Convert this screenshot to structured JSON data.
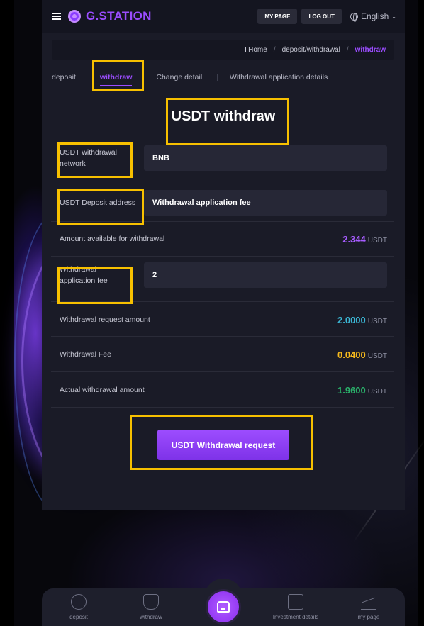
{
  "header": {
    "logo_text": "G.STATION",
    "my_page_label": "MY PAGE",
    "logout_label": "LOG OUT",
    "language": "English"
  },
  "breadcrumb": {
    "home": "Home",
    "section": "deposit/withdrawal",
    "current": "withdraw"
  },
  "tabs": [
    {
      "label": "deposit"
    },
    {
      "label": "withdraw",
      "active": true
    },
    {
      "label": "Change detail"
    },
    {
      "label": "Withdrawal application details"
    }
  ],
  "page_title": "USDT withdraw",
  "form": {
    "network": {
      "label": "USDT withdrawal network",
      "value": "BNB"
    },
    "deposit_address": {
      "label": "USDT Deposit address",
      "value": "Withdrawal application fee"
    },
    "available": {
      "label": "Amount available for withdrawal",
      "amount": "2.344",
      "unit": "USDT"
    },
    "application_fee": {
      "label": "Withdrawal application fee",
      "value": "2"
    },
    "request_amount": {
      "label": "Withdrawal request amount",
      "amount": "2.0000",
      "unit": "USDT"
    },
    "fee": {
      "label": "Withdrawal Fee",
      "amount": "0.0400",
      "unit": "USDT"
    },
    "actual": {
      "label": "Actual withdrawal amount",
      "amount": "1.9600",
      "unit": "USDT"
    }
  },
  "submit_label": "USDT Withdrawal request",
  "bottom_nav": {
    "deposit": "deposit",
    "withdraw": "withdraw",
    "investment": "Investment details",
    "my_page": "my page"
  },
  "colors": {
    "accent": "#9b4dff",
    "highlight": "#f7c000",
    "available": "#a75cff",
    "request": "#3bb6d4",
    "fee": "#f5b91c",
    "actual": "#2ab06a"
  }
}
